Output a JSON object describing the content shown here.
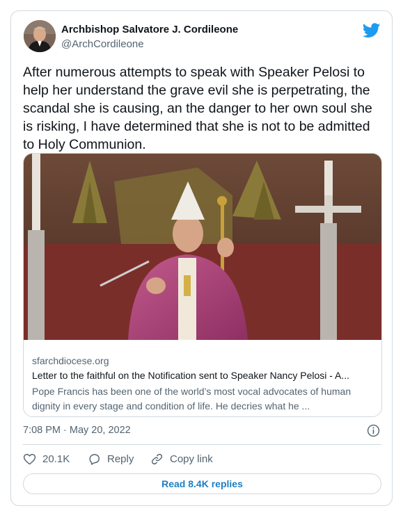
{
  "author": {
    "name": "Archbishop Salvatore J. Cordileone",
    "handle": "@ArchCordileone"
  },
  "tweet": {
    "text": "After numerous attempts to speak with Speaker Pelosi to help her understand the grave evil she is perpetrating, the scandal she is causing, an the danger to her own soul she is risking, I have determined that she is not to be admitted to Holy Communion.",
    "timestamp": "7:08 PM · May 20, 2022"
  },
  "link_card": {
    "domain": "sfarchdiocese.org",
    "title": "Letter to the faithful on the Notification sent to Speaker Nancy Pelosi - A...",
    "description": "Pope Francis has been one of the world’s most vocal advocates of human dignity in every stage and condition of life.  He decries what he ..."
  },
  "actions": {
    "likes": "20.1K",
    "reply_label": "Reply",
    "copy_link_label": "Copy link"
  },
  "replies_button": "Read 8.4K replies",
  "colors": {
    "twitter_blue": "#1d9bf0",
    "text_primary": "#0f1419",
    "text_secondary": "#536471",
    "border": "#cfd9de"
  },
  "icons": [
    "twitter-bird-icon",
    "info-icon",
    "heart-icon",
    "reply-icon",
    "link-icon"
  ]
}
